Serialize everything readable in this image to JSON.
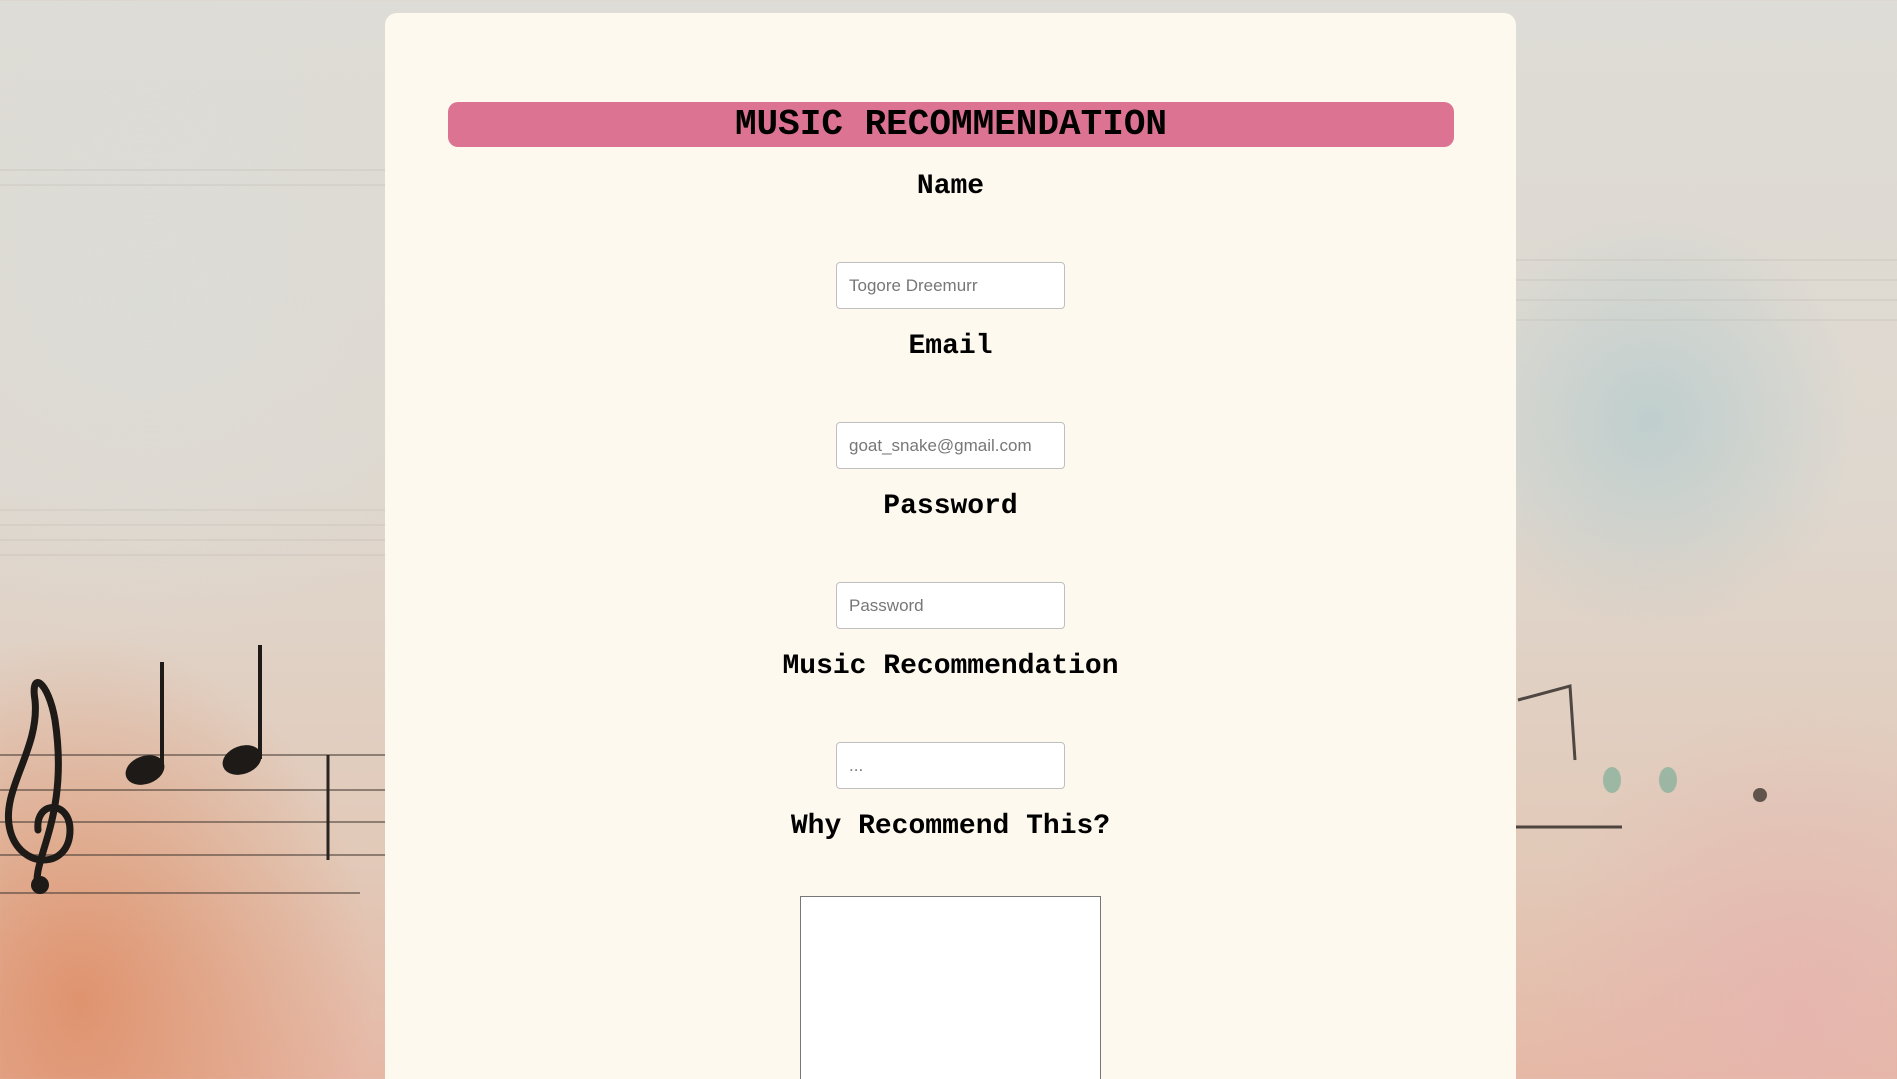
{
  "form": {
    "title": "MUSIC RECOMMENDATION",
    "name_label": "Name",
    "name_placeholder": "Togore Dreemurr",
    "email_label": "Email",
    "email_placeholder": "goat_snake@gmail.com",
    "password_label": "Password",
    "password_placeholder": "Password",
    "music_label": "Music Recommendation",
    "music_placeholder": "...",
    "why_label": "Why Recommend This?",
    "why_value": ""
  },
  "colors": {
    "card_background": "#fdf9ee",
    "title_bar": "#dd7393",
    "text": "#000000"
  }
}
